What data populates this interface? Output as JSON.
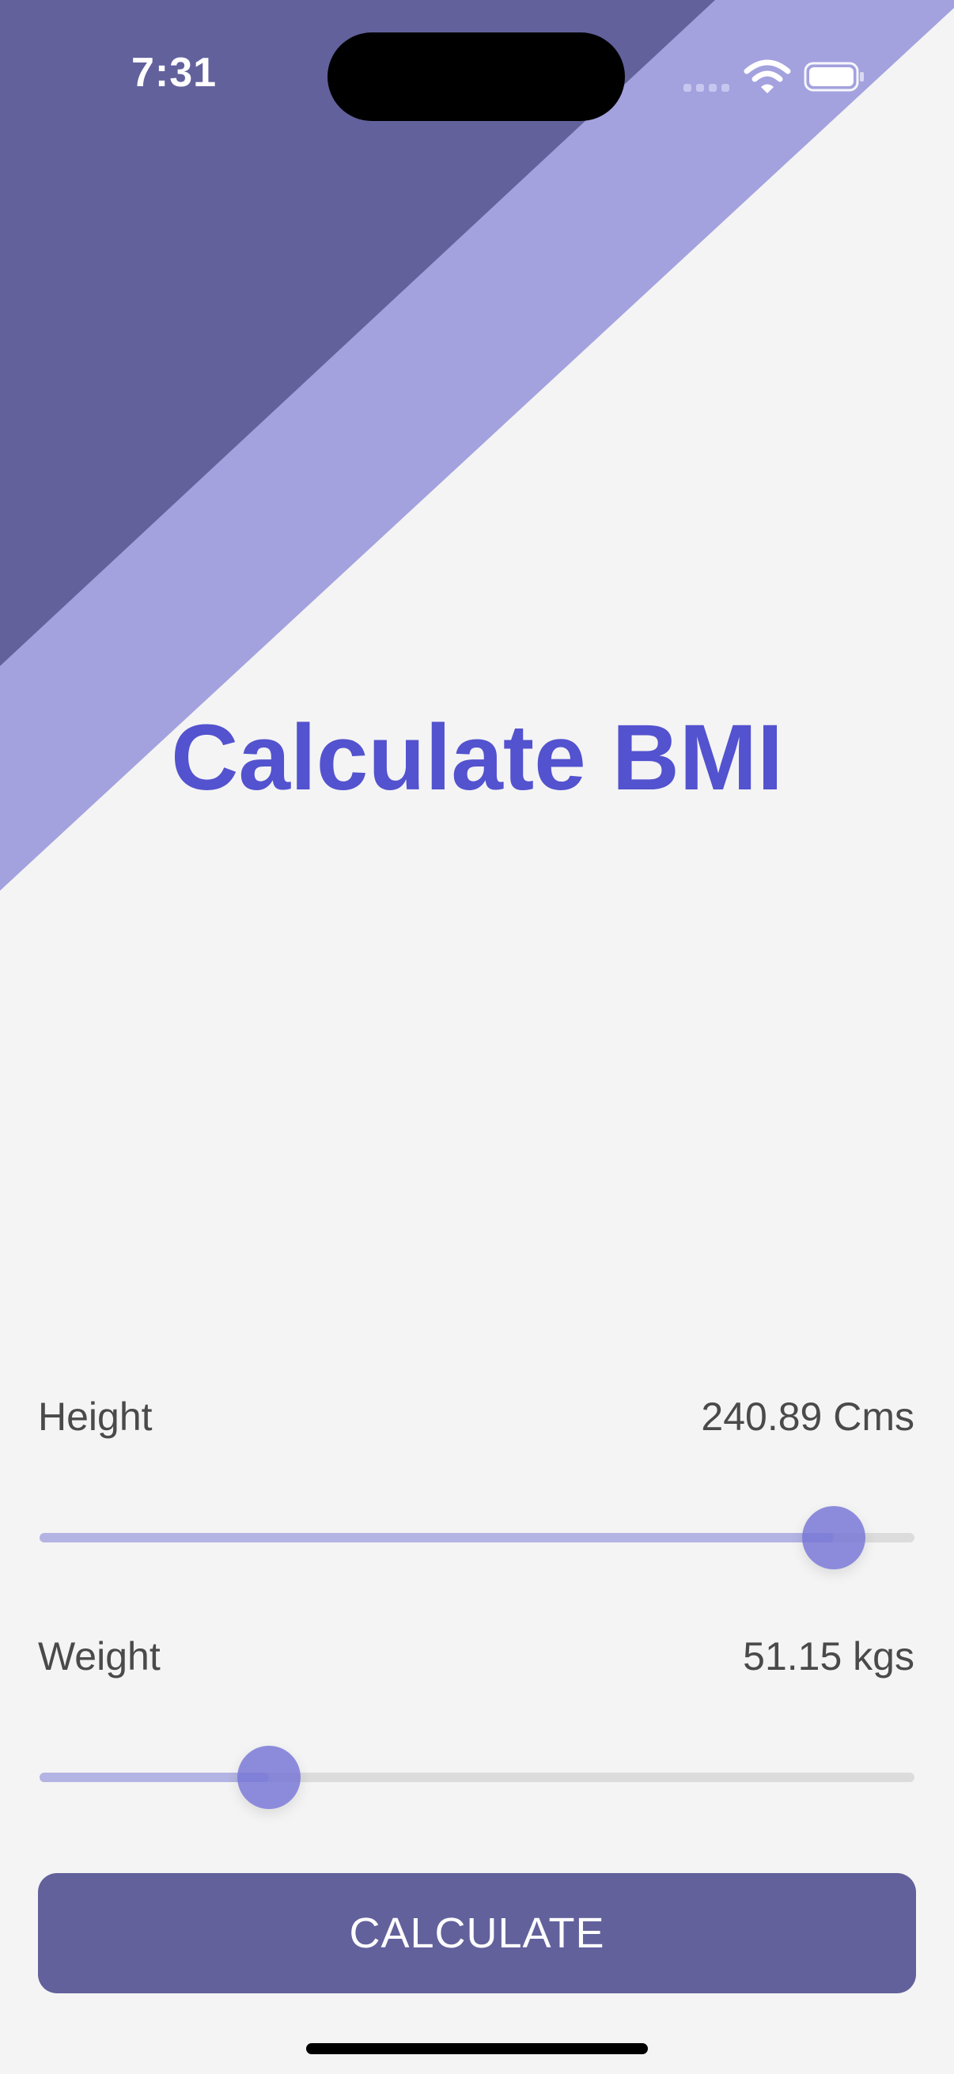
{
  "status_bar": {
    "time": "7:31"
  },
  "title": "Calculate BMI",
  "height": {
    "label": "Height",
    "value": "240.89 Cms",
    "slider_fraction": 0.908
  },
  "weight": {
    "label": "Weight",
    "value": "51.15 kgs",
    "slider_fraction": 0.262
  },
  "calculate_button": {
    "label": "CALCULATE"
  },
  "colors": {
    "background": "#f4f4f4",
    "dark_purple": "#62619c",
    "light_purple": "#a3a1de",
    "title_blue": "#5352cf",
    "button": "#62619c",
    "slider_thumb": "#7574d6",
    "slider_fill": "#b4b4e4",
    "slider_track": "#dcdcdc"
  },
  "icons": {
    "signal": "cellular-signal-icon",
    "wifi": "wifi-icon",
    "battery": "battery-icon"
  }
}
